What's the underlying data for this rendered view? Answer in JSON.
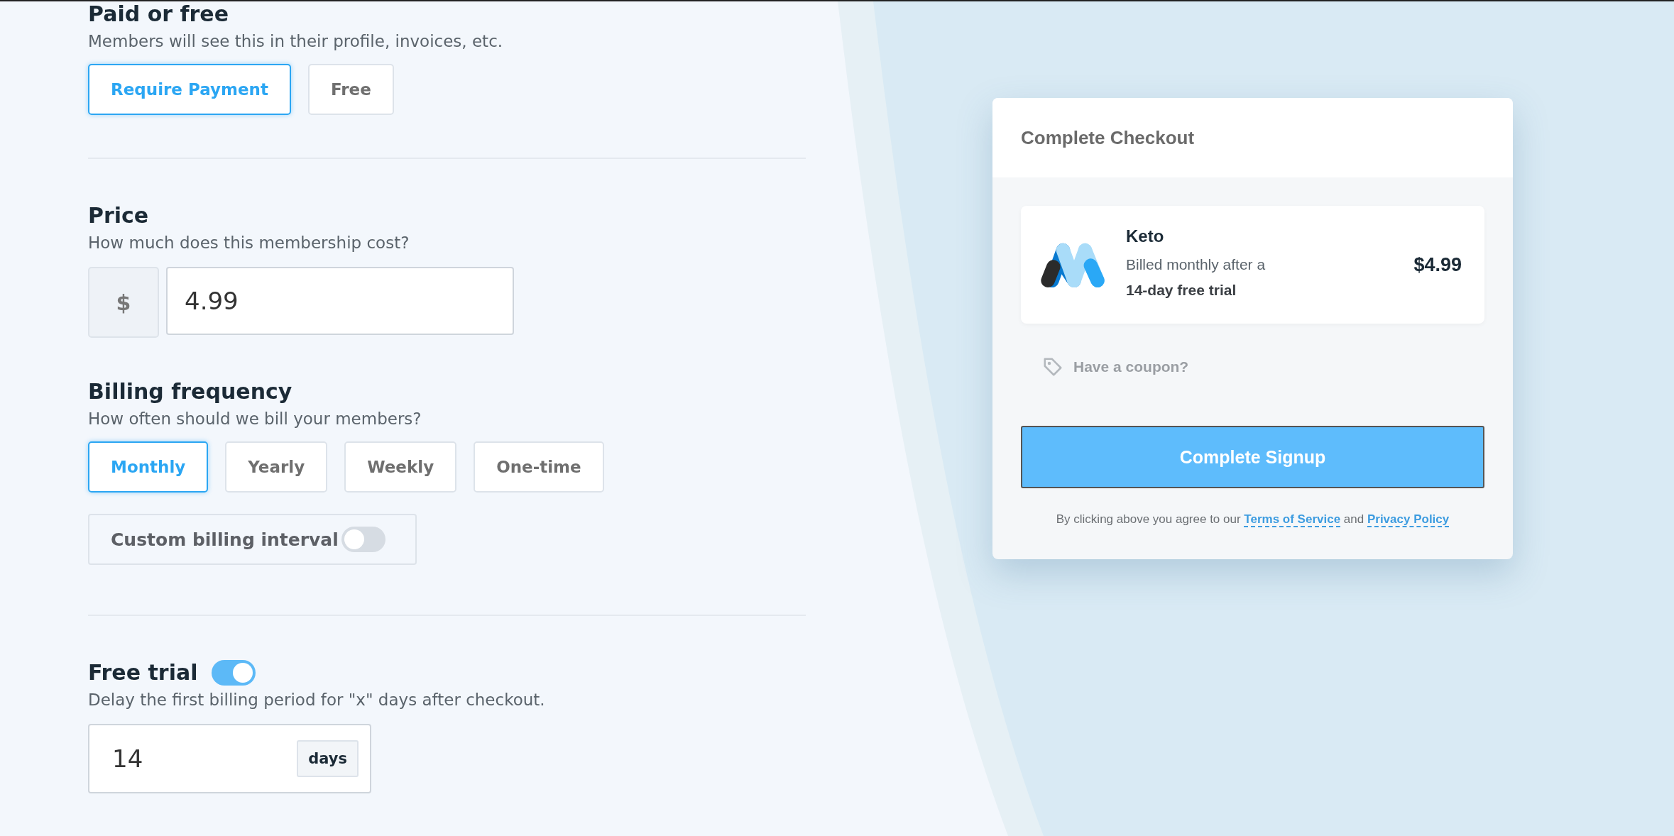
{
  "paid_or_free": {
    "title": "Paid or free",
    "description": "Members will see this in their profile, invoices, etc.",
    "options": [
      {
        "label": "Require Payment",
        "selected": true
      },
      {
        "label": "Free",
        "selected": false
      }
    ]
  },
  "price": {
    "title": "Price",
    "description": "How much does this membership cost?",
    "currency_symbol": "$",
    "value": "4.99"
  },
  "billing_frequency": {
    "title": "Billing frequency",
    "description": "How often should we bill your members?",
    "options": [
      {
        "label": "Monthly",
        "selected": true
      },
      {
        "label": "Yearly",
        "selected": false
      },
      {
        "label": "Weekly",
        "selected": false
      },
      {
        "label": "One-time",
        "selected": false
      }
    ],
    "custom_interval": {
      "label": "Custom billing interval",
      "on": false
    }
  },
  "free_trial": {
    "title": "Free trial",
    "on": true,
    "description": "Delay the first billing period for \"x\" days after checkout.",
    "value": "14",
    "unit": "days"
  },
  "checkout": {
    "title": "Complete Checkout",
    "product": {
      "name": "Keto",
      "line_1": "Billed monthly after a",
      "line_2": "14-day free trial",
      "price": "$4.99"
    },
    "coupon_link": "Have a coupon?",
    "button": "Complete Signup",
    "terms": {
      "prefix": "By clicking above you agree to our",
      "link_1": "Terms of Service",
      "middle": "and",
      "link_2": "Privacy Policy"
    }
  }
}
